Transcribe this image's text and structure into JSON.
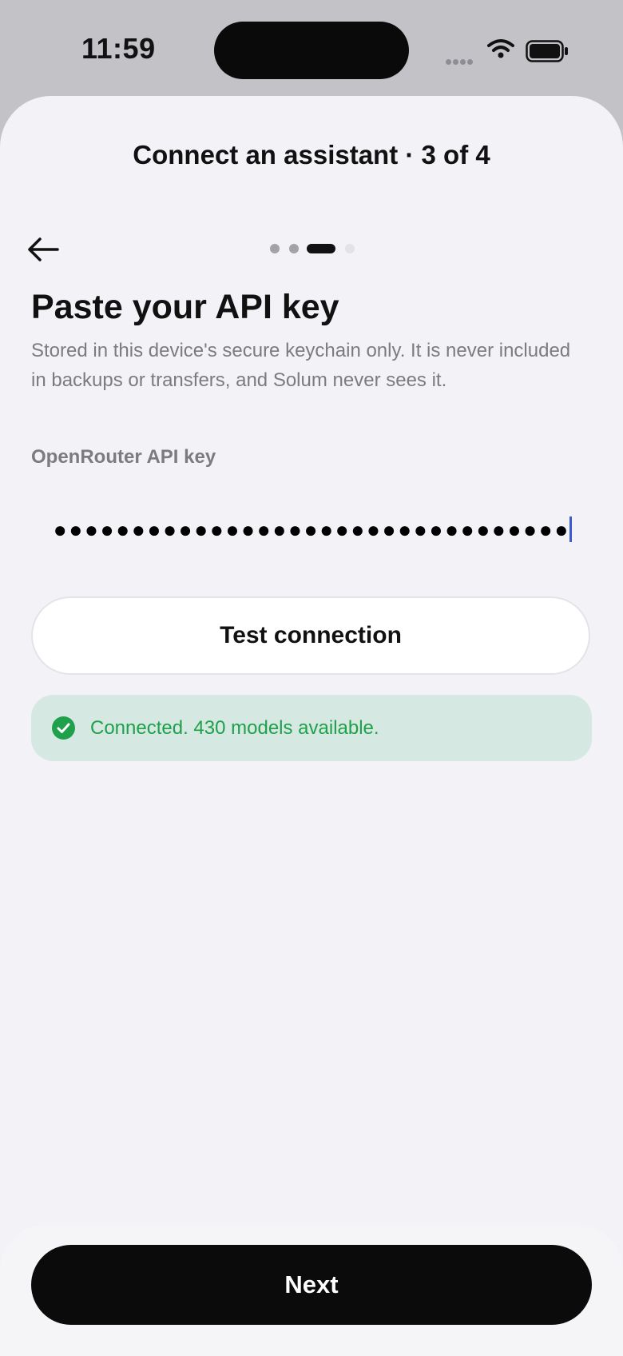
{
  "status_bar": {
    "time": "11:59",
    "icons": [
      "signal-icon",
      "wifi-icon",
      "battery-icon"
    ]
  },
  "header": {
    "title": "Connect an assistant · 3 of 4",
    "back_icon": "arrow-left-icon"
  },
  "progress": {
    "total_steps": 4,
    "current_step": 3
  },
  "content": {
    "heading": "Paste your API key",
    "description": "Stored in this device's secure keychain only. It is never included in backups or transfers, and Solum never sees it.",
    "field_label": "OpenRouter API key",
    "key_value_masked": "●●●●●●●●●●●●●●●●●●●●●●●●●●●●●●●●●●●●"
  },
  "actions": {
    "test_label": "Test connection",
    "next_label": "Next"
  },
  "connection_status": {
    "icon": "checkmark-circle-icon",
    "message": "Connected. 430 models available.",
    "color": "#1fa04a",
    "background": "#d5e8e1"
  },
  "colors": {
    "accent": "#0b0b0b",
    "sheet_bg": "#f2f2f7",
    "caret": "#3a5ccc"
  }
}
